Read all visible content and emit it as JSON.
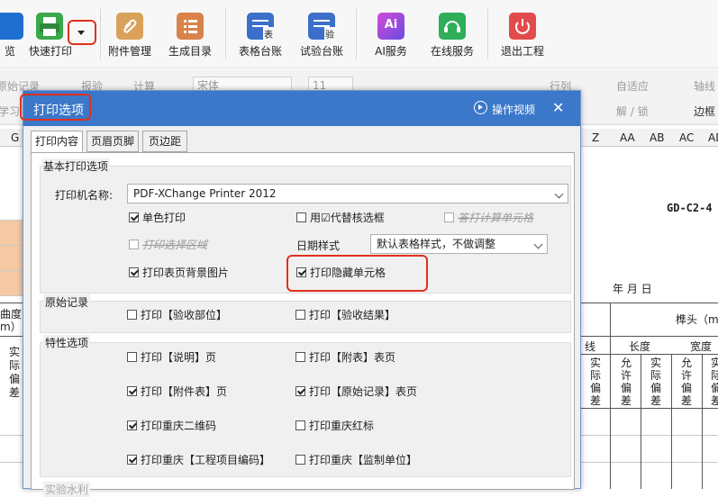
{
  "toolbar": {
    "items": [
      {
        "label": "览",
        "color": "#1f6fd1"
      },
      {
        "label": "快速打印",
        "color": "#3aa84a"
      },
      {
        "label": "附件管理",
        "color": "#d9a15a"
      },
      {
        "label": "生成目录",
        "color": "#d9824a"
      },
      {
        "label": "表格台账",
        "color": "#3b6fc9"
      },
      {
        "label": "试验台账",
        "color": "#3b6fc9"
      },
      {
        "label": "AI服务",
        "color": "#a64bd9"
      },
      {
        "label": "在线服务",
        "color": "#2fae5a"
      },
      {
        "label": "退出工程",
        "color": "#e24b4b"
      }
    ],
    "icon_text": {
      "ledger": "表",
      "test": "验",
      "ai": "Ai"
    }
  },
  "ribbon": {
    "original_record": "原始记录",
    "report": "报验",
    "calc": "计算",
    "font": "宋体",
    "size": "11",
    "row_col": "行列",
    "auto_fit": "自适应",
    "axis": "轴线",
    "study": "学习",
    "unlock": "解 / 锁",
    "border": "边框"
  },
  "sheet": {
    "col_headers": [
      "G",
      "Z",
      "AA",
      "AB",
      "AC",
      "AD"
    ],
    "doc_code": "GD-C2-4",
    "date_label": "年  月  日",
    "peg_head": "榫头（mm",
    "curvature": "曲度",
    "unit": "m）",
    "actual_dev": "实际偏差",
    "allow_dev": "允许偏差",
    "line_col": "线",
    "length": "长度",
    "width": "宽度"
  },
  "dialog": {
    "title": "打印选项",
    "video": "操作视频",
    "tabs": [
      "打印内容",
      "页眉页脚",
      "页边距"
    ],
    "basic": {
      "title": "基本打印选项",
      "printer_label": "打印机名称:",
      "printer_value": "PDF-XChange Printer 2012",
      "mono": "单色打印",
      "replace": "用☑代替核选框",
      "print_calc": "答打计算单元格",
      "print_selection": "打印选择区域",
      "date_style_label": "日期样式",
      "date_style_value": "默认表格样式，不做调整",
      "print_bg": "打印表页背景图片",
      "print_hidden": "打印隐藏单元格"
    },
    "original": {
      "title": "原始记录",
      "accept_part": "打印【验收部位】",
      "accept_result": "打印【验收结果】"
    },
    "feature": {
      "title": "特性选项",
      "explain": "打印【说明】页",
      "appendix": "打印【附表】表页",
      "attach_table": "打印【附件表】页",
      "original_record": "打印【原始记录】表页",
      "qr": "打印重庆二维码",
      "red_stamp": "打印重庆红标",
      "project_code": "打印重庆【工程项目编码】",
      "supervision": "打印重庆【监制单位】"
    },
    "bottom_cut": "实验水利"
  }
}
